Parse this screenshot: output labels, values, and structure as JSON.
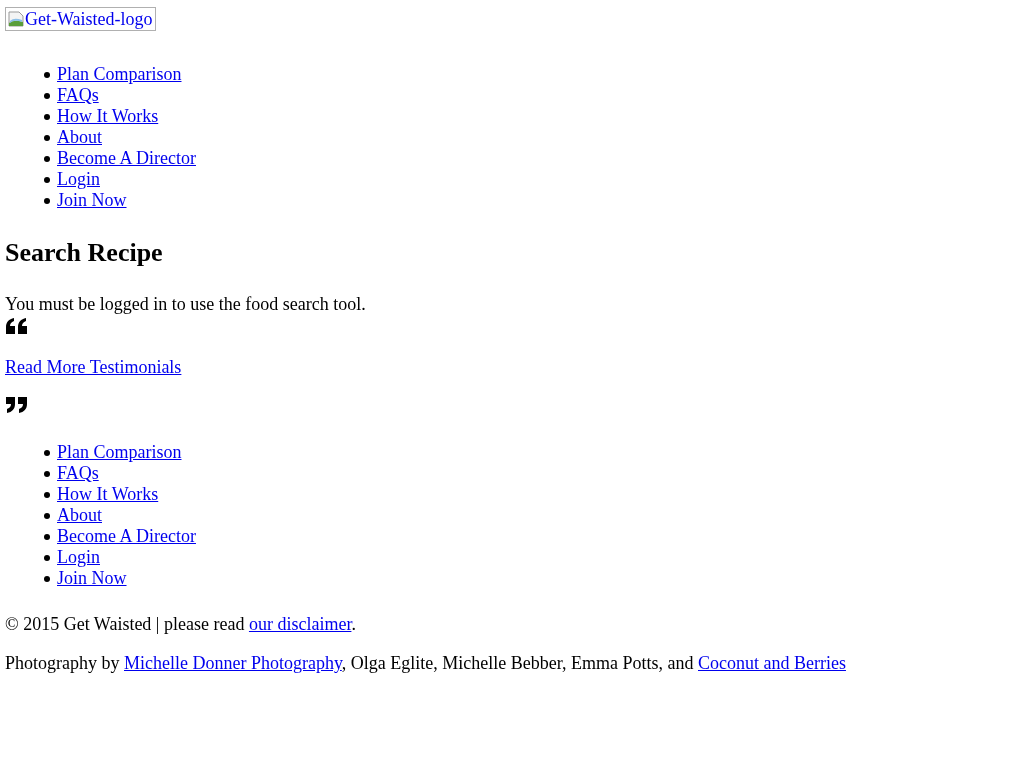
{
  "logo": {
    "alt_text": "Get-Waisted-logo"
  },
  "nav": [
    "Plan Comparison",
    "FAQs",
    "How It Works",
    "About",
    "Become A Director",
    "Login",
    "Join Now"
  ],
  "heading": "Search Recipe",
  "message": "You must be logged in to use the food search tool.",
  "testimonials_link": "Read More Testimonials",
  "footer_nav": [
    "Plan Comparison",
    "FAQs",
    "How It Works",
    "About",
    "Become A Director",
    "Login",
    "Join Now"
  ],
  "copyright": [
    {
      "kind": "text",
      "text": "© 2015 Get Waisted | please read "
    },
    {
      "kind": "link",
      "text": "our disclaimer"
    },
    {
      "kind": "text",
      "text": "."
    }
  ],
  "credits": [
    {
      "kind": "text",
      "text": "Photography by "
    },
    {
      "kind": "link",
      "text": "Michelle Donner Photography"
    },
    {
      "kind": "text",
      "text": ", Olga Eglite, Michelle Bebber, Emma Potts, and "
    },
    {
      "kind": "link",
      "text": "Coconut and Berries"
    }
  ]
}
